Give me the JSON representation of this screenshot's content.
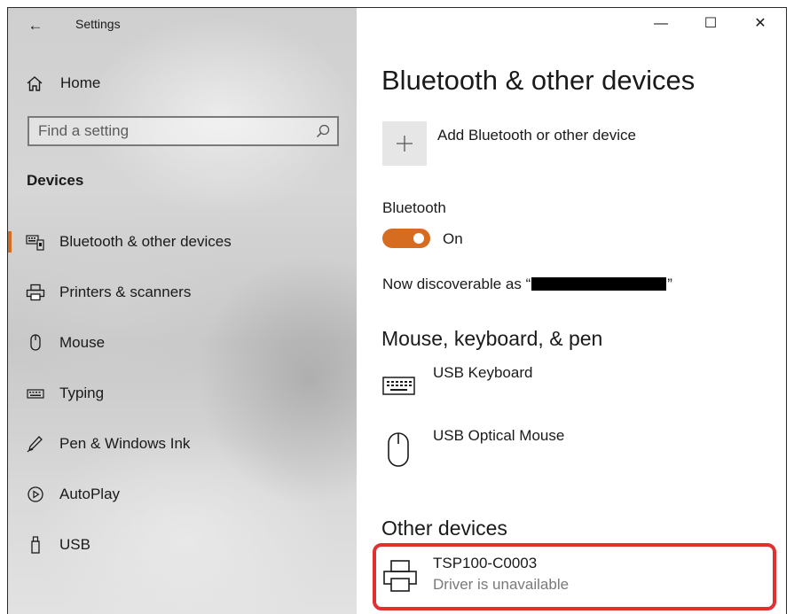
{
  "window": {
    "app_title": "Settings",
    "controls": {
      "minimize": "—",
      "maximize": "☐",
      "close": "✕"
    }
  },
  "nav": {
    "back_glyph": "←",
    "home_label": "Home",
    "search": {
      "placeholder": "Find a setting",
      "value": ""
    },
    "section_heading": "Devices",
    "items": [
      {
        "label": "Bluetooth & other devices",
        "icon": "keyboard-device-icon",
        "selected": true
      },
      {
        "label": "Printers & scanners",
        "icon": "printer-icon",
        "selected": false
      },
      {
        "label": "Mouse",
        "icon": "mouse-icon",
        "selected": false
      },
      {
        "label": "Typing",
        "icon": "keyboard-icon",
        "selected": false
      },
      {
        "label": "Pen & Windows Ink",
        "icon": "pen-icon",
        "selected": false
      },
      {
        "label": "AutoPlay",
        "icon": "autoplay-icon",
        "selected": false
      },
      {
        "label": "USB",
        "icon": "usb-icon",
        "selected": false
      }
    ],
    "accent_color": "#d66c20"
  },
  "content": {
    "page_title": "Bluetooth & other devices",
    "add_device_label": "Add Bluetooth or other device",
    "bluetooth": {
      "label": "Bluetooth",
      "state": "On",
      "on": true,
      "discoverable_prefix": "Now discoverable as “",
      "discoverable_suffix": "”"
    },
    "mouse_keyboard_section": {
      "heading": "Mouse, keyboard, & pen",
      "devices": [
        {
          "name": "USB Keyboard",
          "icon": "keyboard-icon"
        },
        {
          "name": "USB Optical Mouse",
          "icon": "mouse-icon"
        }
      ]
    },
    "other_devices_section": {
      "heading": "Other devices",
      "devices": [
        {
          "name": "TSP100-C0003",
          "status": "Driver is unavailable",
          "icon": "printer-icon"
        }
      ]
    },
    "highlight_color": "#e03131"
  }
}
